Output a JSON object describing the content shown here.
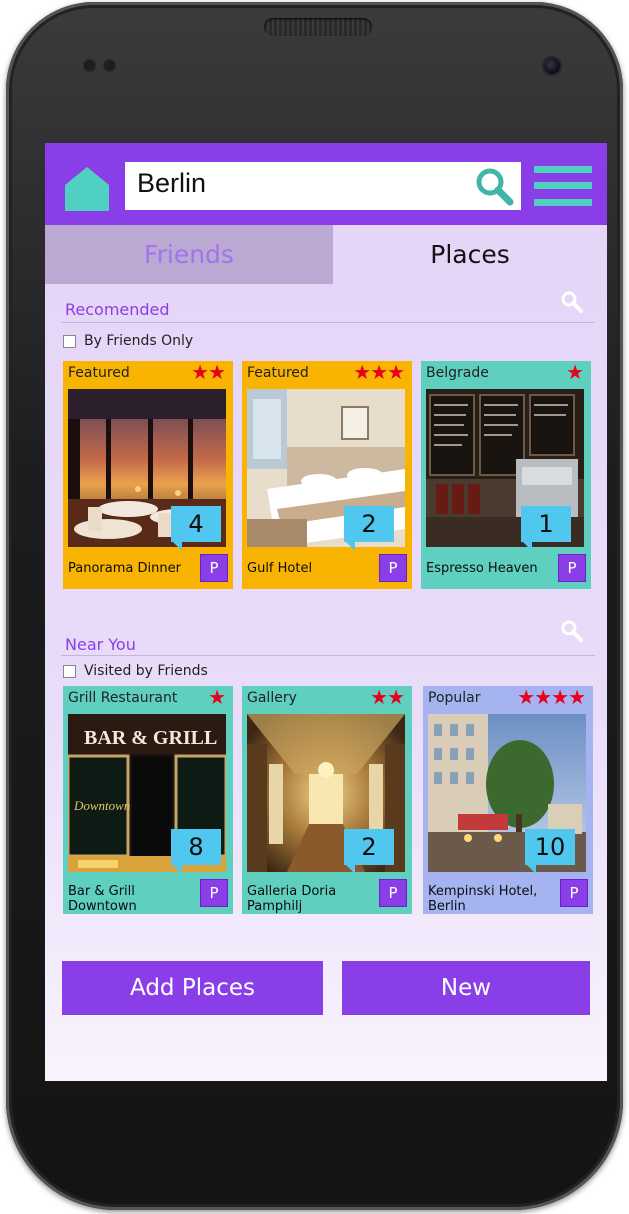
{
  "header": {
    "search_value": "Berlin"
  },
  "tabs": {
    "friends": "Friends",
    "places": "Places"
  },
  "recommended": {
    "title": "Recomended",
    "filter_label": "By Friends Only",
    "cards": [
      {
        "category": "Featured",
        "stars": "★★",
        "count": "4",
        "name": "Panorama Dinner",
        "p": "P"
      },
      {
        "category": "Featured",
        "stars": "★★★",
        "count": "2",
        "name": "Gulf Hotel",
        "p": "P"
      },
      {
        "category": "Belgrade",
        "stars": "★",
        "count": "1",
        "name": "Espresso Heaven",
        "p": "P"
      }
    ]
  },
  "near_you": {
    "title": "Near You",
    "filter_label": "Visited by Friends",
    "cards": [
      {
        "category": "Grill Restaurant",
        "stars": "★",
        "count": "8",
        "name": "Bar & Grill\nDowntown",
        "p": "P",
        "sign_text": "BAR & GRILL",
        "window_text": "Downtown"
      },
      {
        "category": "Gallery",
        "stars": "★★",
        "count": "2",
        "name": "Galleria Doria\nPamphilj",
        "p": "P"
      },
      {
        "category": "Popular",
        "stars": "★★★★",
        "count": "10",
        "name": "Kempinski Hotel,\nBerlin",
        "p": "P"
      }
    ]
  },
  "actions": {
    "add_places": "Add Places",
    "new": "New"
  },
  "colors": {
    "primary": "#8a3ee8",
    "accent": "#4fd0c0",
    "card_featured": "#f8b400",
    "card_teal": "#5fcfc0",
    "card_lavender": "#a5b3f0",
    "star": "#e8001c",
    "count_badge": "#4fc7ee"
  }
}
